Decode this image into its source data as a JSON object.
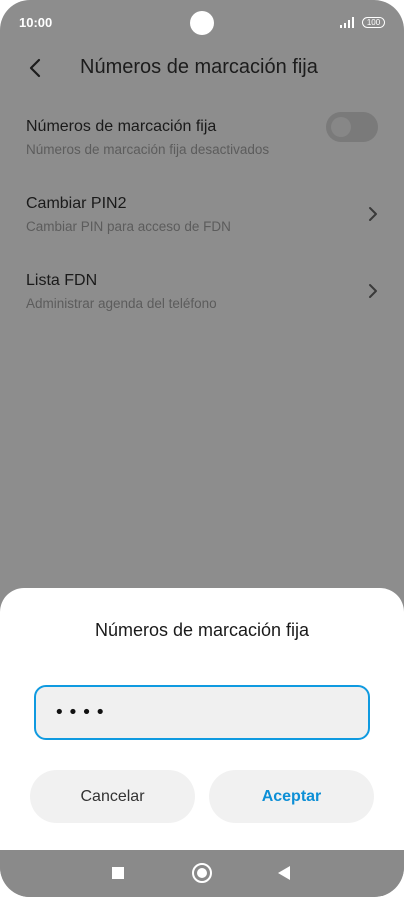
{
  "status_bar": {
    "time": "10:00",
    "battery": "100"
  },
  "header": {
    "title": "Números de marcación fija"
  },
  "settings": {
    "items": [
      {
        "title": "Números de marcación fija",
        "subtitle": "Números de marcación fija desactivados",
        "control": "toggle",
        "toggle_on": false
      },
      {
        "title": "Cambiar PIN2",
        "subtitle": "Cambiar PIN para acceso de FDN",
        "control": "chevron-right-icon"
      },
      {
        "title": "Lista FDN",
        "subtitle": "Administrar agenda del teléfono",
        "control": "chevron-right-icon"
      }
    ]
  },
  "dialog": {
    "title": "Números de marcación fija",
    "pin_value": "••••",
    "cancel_label": "Cancelar",
    "accept_label": "Aceptar"
  },
  "colors": {
    "accent": "#0f9ae0",
    "scrim": "#8d8d8d",
    "dialog_background": "#ffffff"
  },
  "icons": {
    "back": "back-arrow-icon",
    "chevron": "chevron-right-icon",
    "nav_recents": "square-icon",
    "nav_home": "circle-icon",
    "nav_back": "triangle-back-icon"
  }
}
